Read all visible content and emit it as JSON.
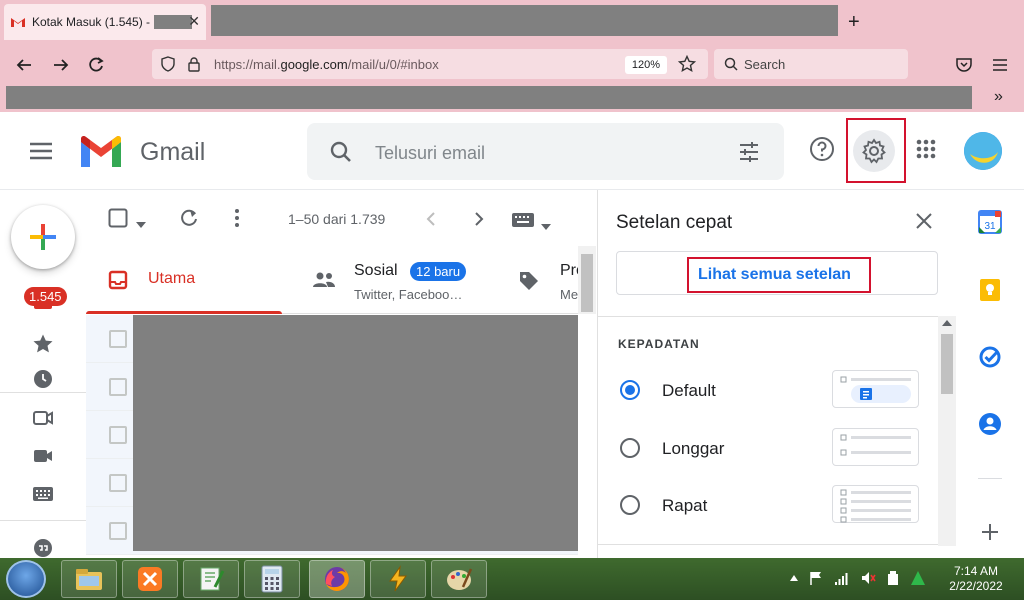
{
  "browser": {
    "tab_title": "Kotak Masuk (1.545) -",
    "url_prefix": "https://mail.",
    "url_domain": "google.com",
    "url_suffix": "/mail/u/0/#inbox",
    "zoom": "120%",
    "search_placeholder": "Search"
  },
  "gmail": {
    "app_name": "Gmail",
    "search_placeholder": "Telusuri email",
    "unread_count": "1.545",
    "pager": "1–50 dari 1.739"
  },
  "tabs": {
    "utama": "Utama",
    "sosial": "Sosial",
    "sosial_badge": "12 baru",
    "sosial_sub": "Twitter, Faceboo…",
    "promo": "Pro",
    "promo_sub": "Me"
  },
  "quick_settings": {
    "title": "Setelan cepat",
    "see_all": "Lihat semua setelan",
    "density_heading": "KEPADATAN",
    "options": [
      "Default",
      "Longgar",
      "Rapat"
    ],
    "selected": "Default"
  },
  "taskbar": {
    "time": "7:14 AM",
    "date": "2/22/2022"
  },
  "colors": {
    "accent_red": "#d93025",
    "link_blue": "#1a73e8",
    "highlight_box": "#d3122e"
  }
}
